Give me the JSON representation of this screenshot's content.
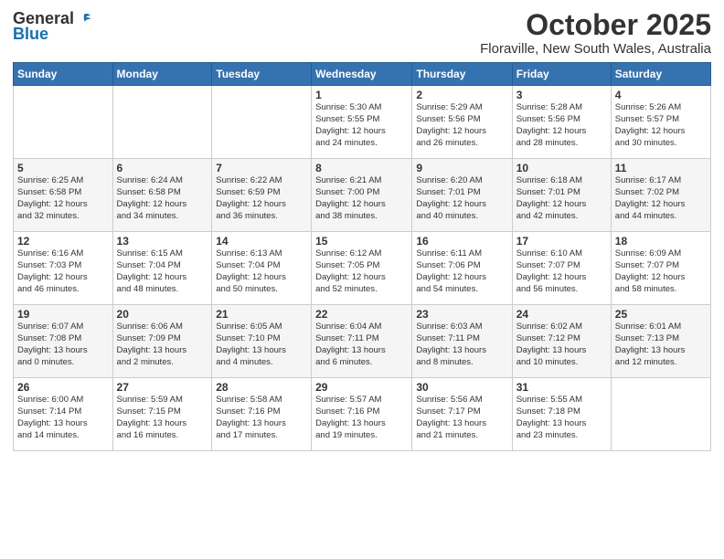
{
  "header": {
    "logo_general": "General",
    "logo_blue": "Blue",
    "month_title": "October 2025",
    "location": "Floraville, New South Wales, Australia"
  },
  "days_of_week": [
    "Sunday",
    "Monday",
    "Tuesday",
    "Wednesday",
    "Thursday",
    "Friday",
    "Saturday"
  ],
  "weeks": [
    [
      {
        "day": "",
        "info": ""
      },
      {
        "day": "",
        "info": ""
      },
      {
        "day": "",
        "info": ""
      },
      {
        "day": "1",
        "info": "Sunrise: 5:30 AM\nSunset: 5:55 PM\nDaylight: 12 hours\nand 24 minutes."
      },
      {
        "day": "2",
        "info": "Sunrise: 5:29 AM\nSunset: 5:56 PM\nDaylight: 12 hours\nand 26 minutes."
      },
      {
        "day": "3",
        "info": "Sunrise: 5:28 AM\nSunset: 5:56 PM\nDaylight: 12 hours\nand 28 minutes."
      },
      {
        "day": "4",
        "info": "Sunrise: 5:26 AM\nSunset: 5:57 PM\nDaylight: 12 hours\nand 30 minutes."
      }
    ],
    [
      {
        "day": "5",
        "info": "Sunrise: 6:25 AM\nSunset: 6:58 PM\nDaylight: 12 hours\nand 32 minutes."
      },
      {
        "day": "6",
        "info": "Sunrise: 6:24 AM\nSunset: 6:58 PM\nDaylight: 12 hours\nand 34 minutes."
      },
      {
        "day": "7",
        "info": "Sunrise: 6:22 AM\nSunset: 6:59 PM\nDaylight: 12 hours\nand 36 minutes."
      },
      {
        "day": "8",
        "info": "Sunrise: 6:21 AM\nSunset: 7:00 PM\nDaylight: 12 hours\nand 38 minutes."
      },
      {
        "day": "9",
        "info": "Sunrise: 6:20 AM\nSunset: 7:01 PM\nDaylight: 12 hours\nand 40 minutes."
      },
      {
        "day": "10",
        "info": "Sunrise: 6:18 AM\nSunset: 7:01 PM\nDaylight: 12 hours\nand 42 minutes."
      },
      {
        "day": "11",
        "info": "Sunrise: 6:17 AM\nSunset: 7:02 PM\nDaylight: 12 hours\nand 44 minutes."
      }
    ],
    [
      {
        "day": "12",
        "info": "Sunrise: 6:16 AM\nSunset: 7:03 PM\nDaylight: 12 hours\nand 46 minutes."
      },
      {
        "day": "13",
        "info": "Sunrise: 6:15 AM\nSunset: 7:04 PM\nDaylight: 12 hours\nand 48 minutes."
      },
      {
        "day": "14",
        "info": "Sunrise: 6:13 AM\nSunset: 7:04 PM\nDaylight: 12 hours\nand 50 minutes."
      },
      {
        "day": "15",
        "info": "Sunrise: 6:12 AM\nSunset: 7:05 PM\nDaylight: 12 hours\nand 52 minutes."
      },
      {
        "day": "16",
        "info": "Sunrise: 6:11 AM\nSunset: 7:06 PM\nDaylight: 12 hours\nand 54 minutes."
      },
      {
        "day": "17",
        "info": "Sunrise: 6:10 AM\nSunset: 7:07 PM\nDaylight: 12 hours\nand 56 minutes."
      },
      {
        "day": "18",
        "info": "Sunrise: 6:09 AM\nSunset: 7:07 PM\nDaylight: 12 hours\nand 58 minutes."
      }
    ],
    [
      {
        "day": "19",
        "info": "Sunrise: 6:07 AM\nSunset: 7:08 PM\nDaylight: 13 hours\nand 0 minutes."
      },
      {
        "day": "20",
        "info": "Sunrise: 6:06 AM\nSunset: 7:09 PM\nDaylight: 13 hours\nand 2 minutes."
      },
      {
        "day": "21",
        "info": "Sunrise: 6:05 AM\nSunset: 7:10 PM\nDaylight: 13 hours\nand 4 minutes."
      },
      {
        "day": "22",
        "info": "Sunrise: 6:04 AM\nSunset: 7:11 PM\nDaylight: 13 hours\nand 6 minutes."
      },
      {
        "day": "23",
        "info": "Sunrise: 6:03 AM\nSunset: 7:11 PM\nDaylight: 13 hours\nand 8 minutes."
      },
      {
        "day": "24",
        "info": "Sunrise: 6:02 AM\nSunset: 7:12 PM\nDaylight: 13 hours\nand 10 minutes."
      },
      {
        "day": "25",
        "info": "Sunrise: 6:01 AM\nSunset: 7:13 PM\nDaylight: 13 hours\nand 12 minutes."
      }
    ],
    [
      {
        "day": "26",
        "info": "Sunrise: 6:00 AM\nSunset: 7:14 PM\nDaylight: 13 hours\nand 14 minutes."
      },
      {
        "day": "27",
        "info": "Sunrise: 5:59 AM\nSunset: 7:15 PM\nDaylight: 13 hours\nand 16 minutes."
      },
      {
        "day": "28",
        "info": "Sunrise: 5:58 AM\nSunset: 7:16 PM\nDaylight: 13 hours\nand 17 minutes."
      },
      {
        "day": "29",
        "info": "Sunrise: 5:57 AM\nSunset: 7:16 PM\nDaylight: 13 hours\nand 19 minutes."
      },
      {
        "day": "30",
        "info": "Sunrise: 5:56 AM\nSunset: 7:17 PM\nDaylight: 13 hours\nand 21 minutes."
      },
      {
        "day": "31",
        "info": "Sunrise: 5:55 AM\nSunset: 7:18 PM\nDaylight: 13 hours\nand 23 minutes."
      },
      {
        "day": "",
        "info": ""
      }
    ]
  ]
}
